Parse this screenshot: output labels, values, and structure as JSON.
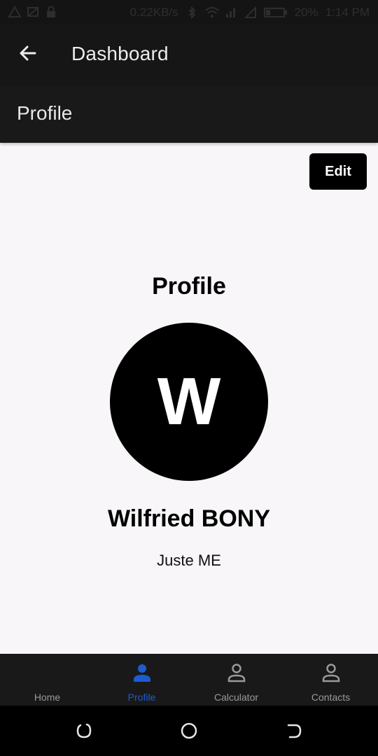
{
  "status_bar": {
    "network_speed": "0.22KB/s",
    "battery": "20%",
    "time": "1:14 PM"
  },
  "app_bar": {
    "title": "Dashboard",
    "back_icon": "arrow-left-icon"
  },
  "sub_header": {
    "title": "Profile"
  },
  "content": {
    "edit_label": "Edit",
    "heading": "Profile",
    "avatar_initial": "W",
    "name": "Wilfried BONY",
    "bio": "Juste ME"
  },
  "bottom_nav": {
    "items": [
      {
        "label": "Home",
        "icon": "home-icon",
        "active": false
      },
      {
        "label": "Profile",
        "icon": "person-icon",
        "active": true
      },
      {
        "label": "Calculator",
        "icon": "person-outline-icon",
        "active": false
      },
      {
        "label": "Contacts",
        "icon": "person-outline-icon",
        "active": false
      }
    ]
  },
  "colors": {
    "active_tab": "#1e5bd0",
    "inactive_tab": "#9a9a9a",
    "app_bar_bg": "#161616",
    "content_bg": "#f8f6f8"
  }
}
